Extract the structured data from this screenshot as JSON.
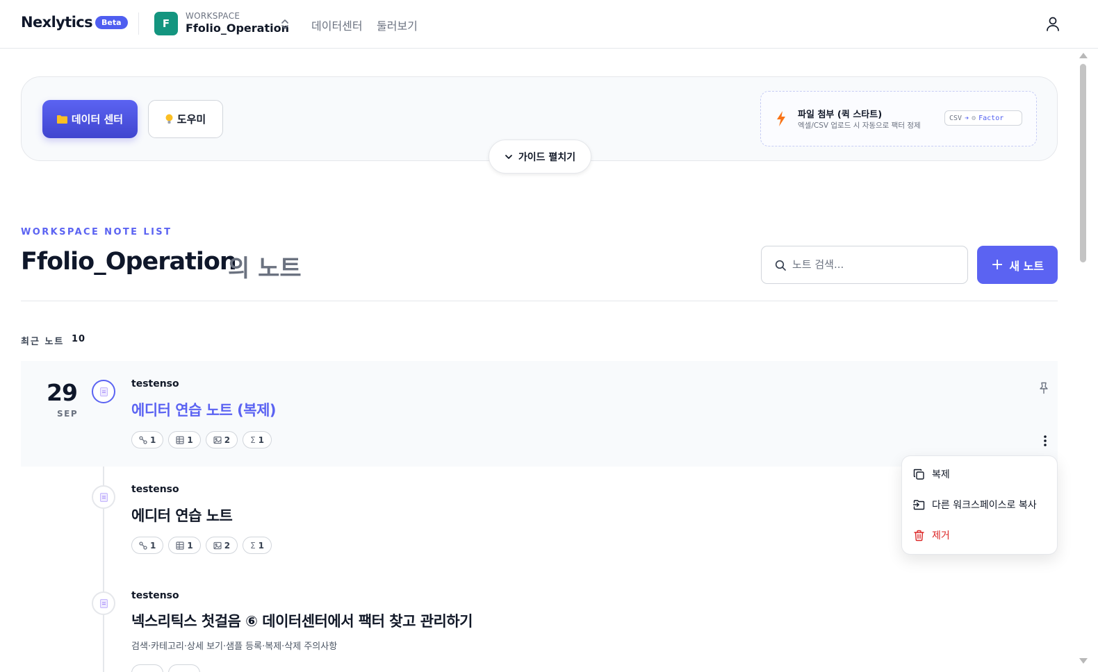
{
  "header": {
    "brand": "Nexlytics",
    "badge": "Beta",
    "workspace_initial": "F",
    "workspace_label": "WORKSPACE",
    "workspace_name": "Ffolio_Operation",
    "nav": [
      "데이터센터",
      "둘러보기"
    ]
  },
  "toolbar": {
    "data_center_label": "데이터 센터",
    "help_label": "도우미",
    "guide_label": "가이드 펼치기",
    "quick_start": {
      "title": "파일 첨부 (퀵 스타트)",
      "subtitle": "엑셀/CSV 업로드 시 자동으로 팩터 정제",
      "chip_from": "CSV",
      "chip_arrow": "➔",
      "chip_to": "Factor"
    }
  },
  "section": {
    "eyebrow": "WORKSPACE NOTE LIST",
    "title": "Ffolio_Operation",
    "title_suffix": "의 노트",
    "search_placeholder": "노트 검색...",
    "new_note_label": "새 노트",
    "recent_label": "최근 노트",
    "recent_count": "10"
  },
  "notes": [
    {
      "day": "29",
      "month": "SEP",
      "author": "testenso",
      "title": "에디터 연습 노트 (복제)",
      "chips": {
        "links": "1",
        "tables": "1",
        "images": "2",
        "formulas": "1"
      }
    },
    {
      "author": "testenso",
      "title": "에디터 연습 노트",
      "chips": {
        "links": "1",
        "tables": "1",
        "images": "2",
        "formulas": "1"
      }
    },
    {
      "author": "testenso",
      "title": "넥스리틱스 첫걸음 ⑥ 데이터센터에서 팩터 찾고 관리하기",
      "description": "검색·카테고리·상세 보기·샘플 등록·복제·삭제 주의사항"
    }
  ],
  "context_menu": {
    "duplicate": "복제",
    "copy_to_workspace": "다른 워크스페이스로 복사",
    "remove": "제거"
  },
  "colors": {
    "accent": "#5b63f2",
    "workspace_avatar": "#14957f",
    "danger": "#dc2626"
  }
}
